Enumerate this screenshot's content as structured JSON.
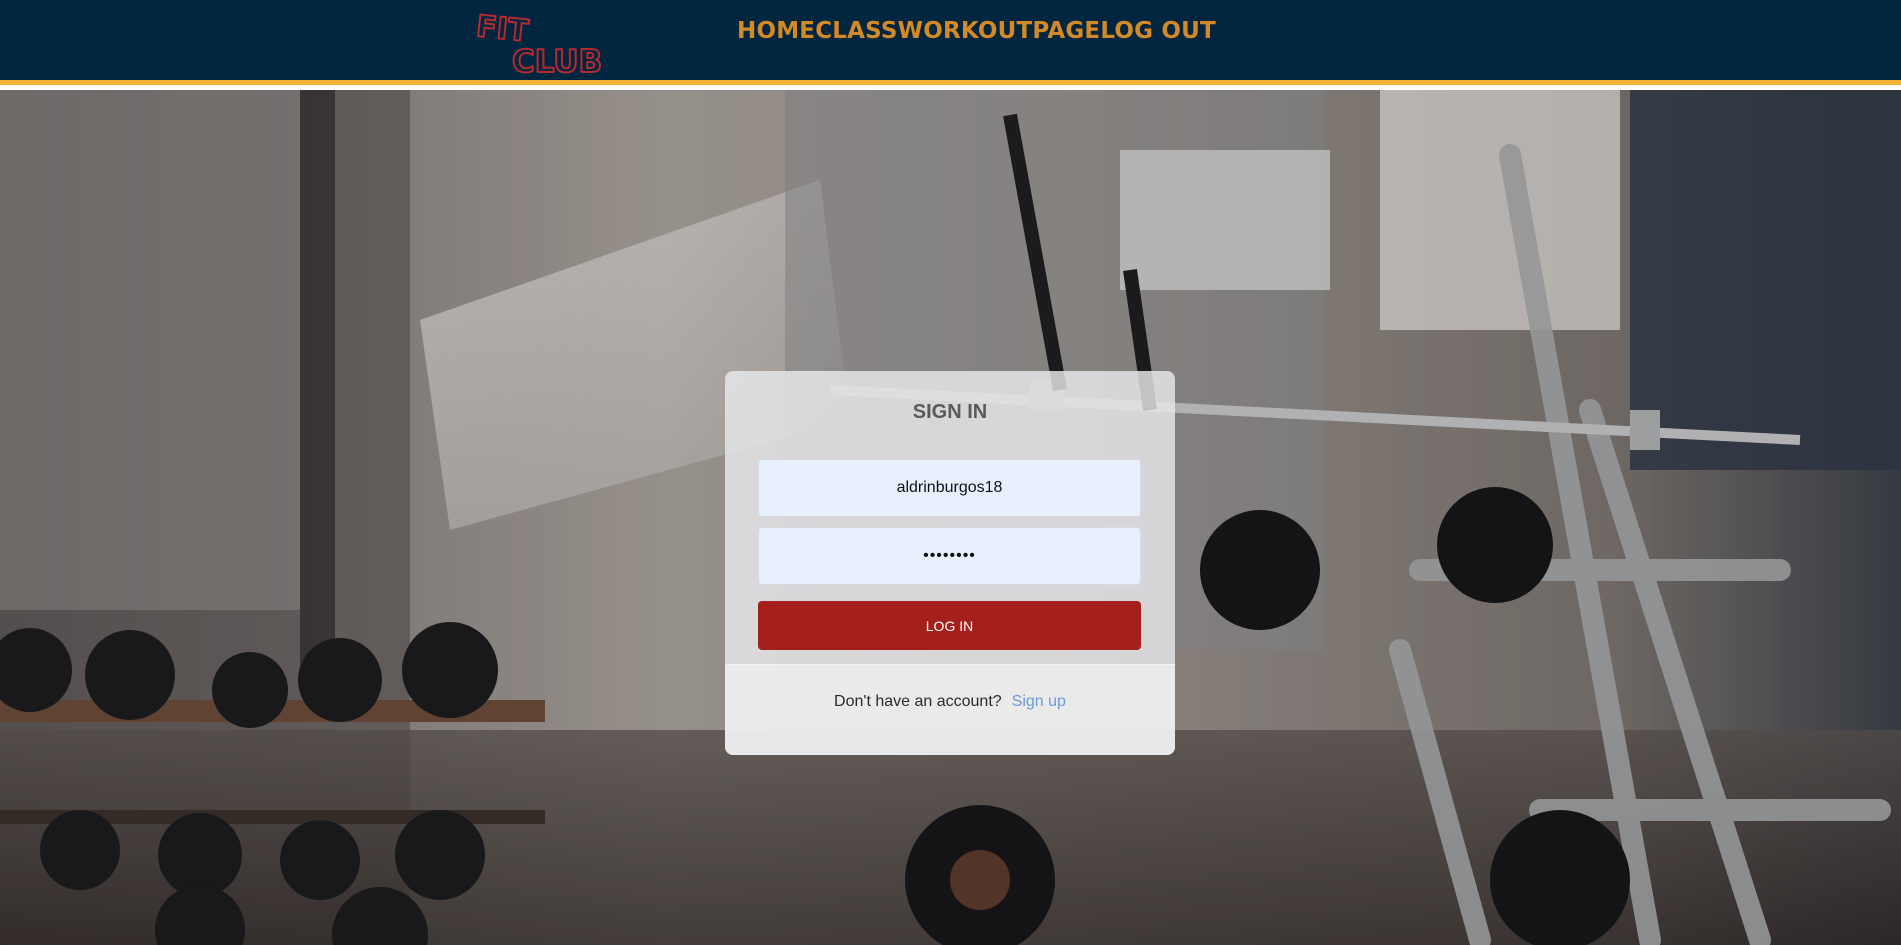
{
  "brand": {
    "logo_text_line1": "FIT",
    "logo_text_line2": "CLUB"
  },
  "nav": {
    "items": [
      {
        "label": "HOME"
      },
      {
        "label": "CLASS"
      },
      {
        "label": "WORKOUTPAGE"
      },
      {
        "label": "LOG OUT"
      }
    ]
  },
  "login": {
    "title": "SIGN IN",
    "username_value": "aldrinburgos18",
    "password_value": "••••••••",
    "submit_label": "LOG IN",
    "footer_prompt": "Don't have an account?",
    "signup_label": "Sign up"
  },
  "colors": {
    "navbar_bg": "#022540",
    "navbar_border": "#f2b23a",
    "nav_text": "#d38a26",
    "logo": "#b42a30",
    "button": "#a51f1d",
    "link": "#6b9ad6"
  },
  "background": {
    "image": "gym-equipment-photo"
  }
}
